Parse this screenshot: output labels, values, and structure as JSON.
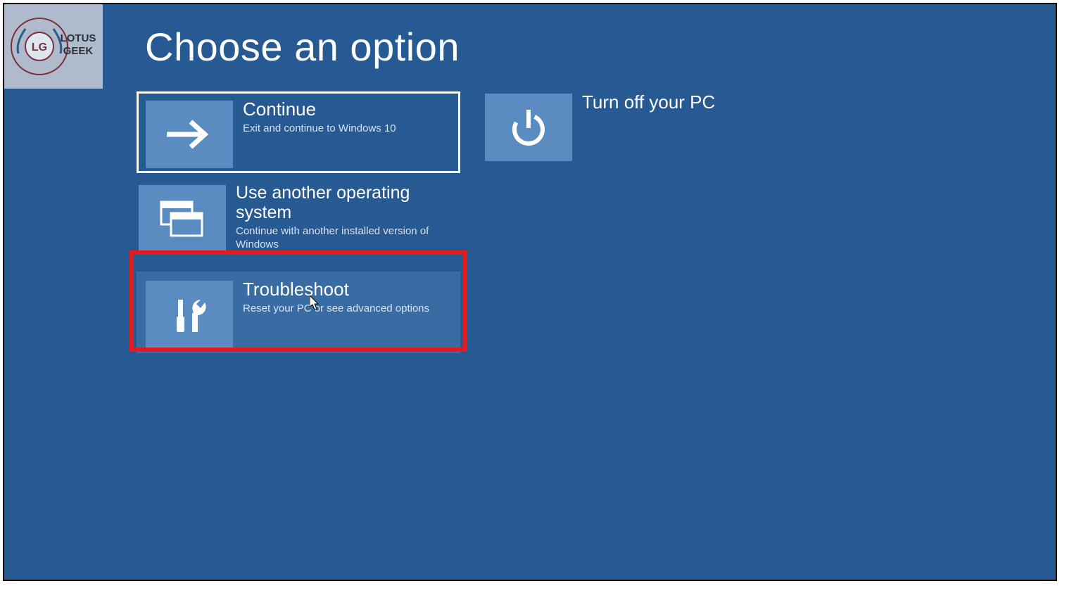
{
  "heading": "Choose an option",
  "watermark": {
    "badge": "LG",
    "line1": "LOTUS",
    "line2": "GEEK"
  },
  "options": {
    "continue": {
      "title": "Continue",
      "desc": "Exit and continue to Windows 10"
    },
    "use_other_os": {
      "title": "Use another operating system",
      "desc": "Continue with another installed version of Windows"
    },
    "troubleshoot": {
      "title": "Troubleshoot",
      "desc": "Reset your PC or see advanced options"
    },
    "turnoff": {
      "title": "Turn off your PC",
      "desc": ""
    }
  },
  "colors": {
    "bg": "#275993",
    "tile": "#5a8bc1",
    "highlight": "#e31b1b"
  }
}
